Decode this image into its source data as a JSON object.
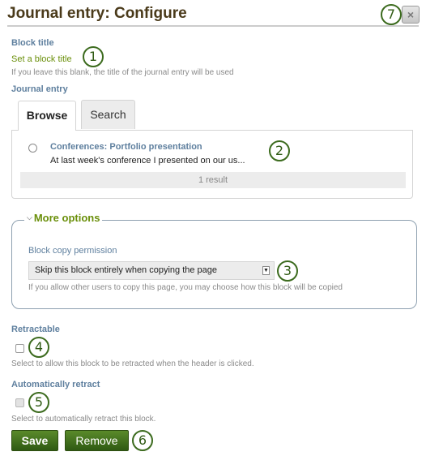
{
  "dialog": {
    "title": "Journal entry: Configure",
    "close_icon": "×"
  },
  "callouts": [
    "1",
    "2",
    "3",
    "4",
    "5",
    "6",
    "7"
  ],
  "block_title": {
    "label": "Block title",
    "value": "Set a block title",
    "help": "If you leave this blank, the title of the journal entry will be used"
  },
  "journal_entry": {
    "label": "Journal entry",
    "tabs": [
      {
        "label": "Browse",
        "active": true
      },
      {
        "label": "Search",
        "active": false
      }
    ],
    "results": [
      {
        "title": "Conferences: Portfolio presentation",
        "excerpt": "At last week's conference I presented on our us..."
      }
    ],
    "result_count": "1 result"
  },
  "more_options": {
    "legend": "More options",
    "chevron_icon": "❯",
    "copy_permission": {
      "label": "Block copy permission",
      "selected": "Skip this block entirely when copying the page",
      "help": "If you allow other users to copy this page, you may choose how this block will be copied"
    }
  },
  "retractable": {
    "label": "Retractable",
    "checked": false,
    "help": "Select to allow this block to be retracted when the header is clicked."
  },
  "auto_retract": {
    "label": "Automatically retract",
    "checked": false,
    "disabled": true,
    "help": "Select to automatically retract this block."
  },
  "buttons": {
    "save": "Save",
    "remove": "Remove"
  }
}
